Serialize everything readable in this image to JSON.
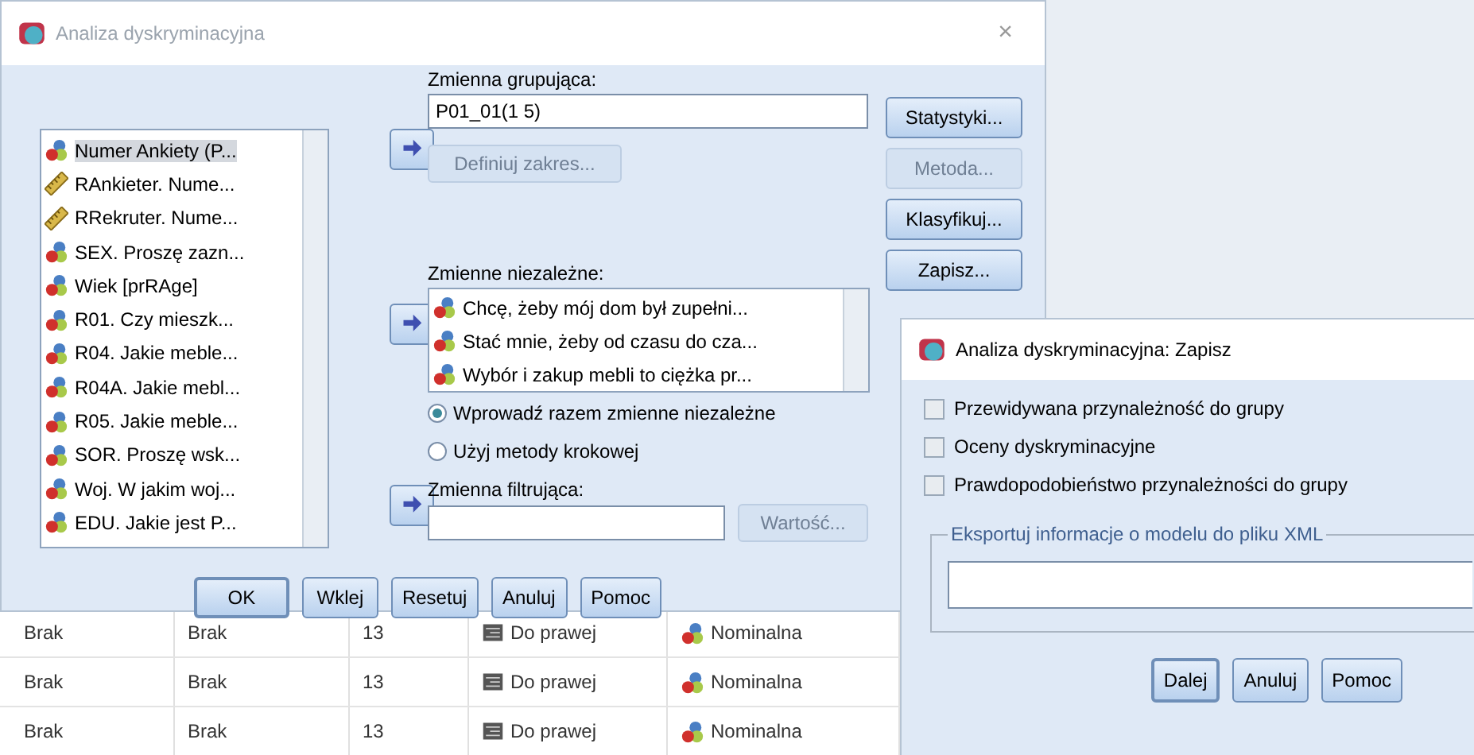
{
  "main_dialog": {
    "title": "Analiza dyskryminacyjna",
    "close": "×",
    "variables": [
      {
        "label": "Numer Ankiety (P...",
        "kind": "nominal",
        "selected": true
      },
      {
        "label": "RAnkieter. Nume...",
        "kind": "scale",
        "selected": false
      },
      {
        "label": "RRekruter. Nume...",
        "kind": "scale",
        "selected": false
      },
      {
        "label": "SEX. Proszę zazn...",
        "kind": "nominal",
        "selected": false
      },
      {
        "label": "Wiek [prRAge]",
        "kind": "nominal",
        "selected": false
      },
      {
        "label": "R01. Czy mieszk...",
        "kind": "nominal",
        "selected": false
      },
      {
        "label": "R04. Jakie meble...",
        "kind": "nominal",
        "selected": false
      },
      {
        "label": "R04A. Jakie mebl...",
        "kind": "nominal",
        "selected": false
      },
      {
        "label": "R05. Jakie meble...",
        "kind": "nominal",
        "selected": false
      },
      {
        "label": "SOR. Proszę wsk...",
        "kind": "nominal",
        "selected": false
      },
      {
        "label": "Woj. W jakim woj...",
        "kind": "nominal",
        "selected": false
      },
      {
        "label": "EDU. Jakie jest P...",
        "kind": "nominal",
        "selected": false
      }
    ],
    "grouping": {
      "label": "Zmienna grupująca:",
      "value": "P01_01(1 5)"
    },
    "define_range": {
      "label": "Definiuj zakres...",
      "disabled": true
    },
    "independents": {
      "label": "Zmienne niezależne:",
      "items": [
        {
          "label": "Chcę, żeby mój dom był zupełni...",
          "kind": "nominal"
        },
        {
          "label": "Stać mnie, żeby od czasu do cza...",
          "kind": "nominal"
        },
        {
          "label": "Wybór i zakup mebli to ciężka pr...",
          "kind": "nominal"
        }
      ]
    },
    "methods": [
      {
        "label": "Wprowadź razem zmienne niezależne",
        "selected": true
      },
      {
        "label": "Użyj metody krokowej",
        "selected": false
      }
    ],
    "filter": {
      "label": "Zmienna filtrująca:"
    },
    "value_button": {
      "label": "Wartość...",
      "disabled": true
    },
    "side_buttons": [
      {
        "label": "Statystyki...",
        "disabled": false
      },
      {
        "label": "Metoda...",
        "disabled": true
      },
      {
        "label": "Klasyfikuj...",
        "disabled": false
      },
      {
        "label": "Zapisz...",
        "disabled": false
      }
    ],
    "buttons": [
      {
        "label": "OK"
      },
      {
        "label": "Wklej"
      },
      {
        "label": "Resetuj"
      },
      {
        "label": "Anuluj"
      },
      {
        "label": "Pomoc"
      }
    ]
  },
  "data_grid": {
    "rows": [
      {
        "cells": [
          "Brak",
          "Brak",
          "13",
          "Do prawej",
          "Nominalna"
        ]
      },
      {
        "cells": [
          "Brak",
          "Brak",
          "13",
          "Do prawej",
          "Nominalna"
        ]
      },
      {
        "cells": [
          "Brak",
          "Brak",
          "13",
          "Do prawej",
          "Nominalna"
        ]
      }
    ]
  },
  "save_dialog": {
    "title": "Analiza dyskryminacyjna: Zapisz",
    "options": [
      {
        "label": "Przewidywana przynależność do grupy",
        "checked": false
      },
      {
        "label": "Oceny dyskryminacyjne",
        "checked": false
      },
      {
        "label": "Prawdopodobieństwo przynależności do grupy",
        "checked": false
      }
    ],
    "export": {
      "label": "Eksportuj informacje o modelu do pliku XML"
    },
    "buttons": [
      {
        "label": "Dalej"
      },
      {
        "label": "Anuluj"
      },
      {
        "label": "Pomoc"
      }
    ]
  }
}
